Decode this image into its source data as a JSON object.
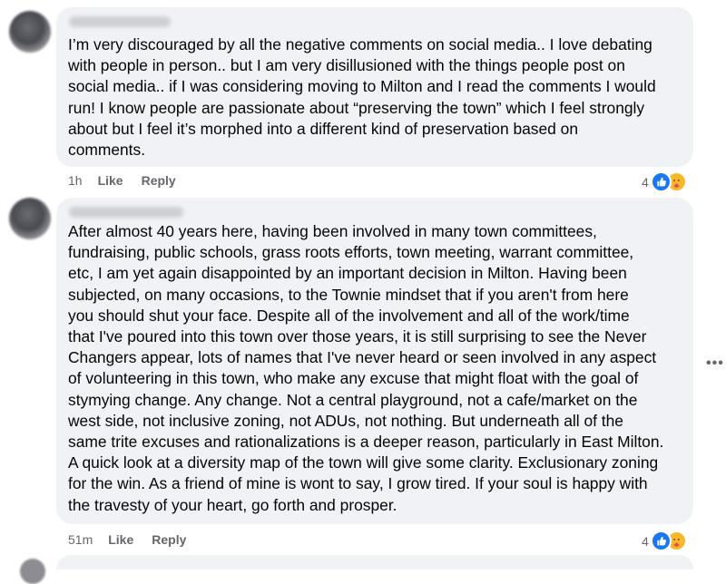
{
  "comments": [
    {
      "text": "I’m very discouraged by all the negative comments on social media.. I love debating\nwith people in person.. but I am very disillusioned with the things people post on\nsocial media.. if I was considering moving to Milton and I read the comments I would\nrun! I know people are passionate about “preserving the town” which I feel strongly\nabout but I feel it’s morphed into a different kind of preservation based on\ncomments.",
      "time": "1h",
      "like_label": "Like",
      "reply_label": "Reply",
      "reaction_count": "4"
    },
    {
      "text": "After almost 40 years here, having been involved in many town committees,\nfundraising, public schools, grass roots efforts, town meeting, warrant committee,\netc, I am yet again disappointed by an important decision in Milton. Having been\nsubjected, on many occasions, to the Townie mindset that if you aren't from here\nyou should shut your face. Despite all of the involvement and all of the work/time\nthat I've poured into this town over those years, it is still surprising to see the Never\nChangers appear, lots of names that I've never heard or seen involved in any aspect\nof volunteering in this town, who make any excuse that might float with the goal of\nstymying change. Any change. Not a central playground, not a cafe/market on the\nwest side, not inclusive zoning, not ADUs, not nothing. But underneath all of the\nsame trite excuses and rationalizations is a deeper reason, particularly in East Milton.\nA quick look at a diversity map of the town will give some clarity. Exclusionary zoning\nfor the win. As a friend of mine is wont to say, I grow tired. If your soul is happy with\nthe travesty of your heart, go forth and prosper.",
      "time": "51m",
      "like_label": "Like",
      "reply_label": "Reply",
      "reaction_count": "4"
    }
  ],
  "icons": {
    "like": "like-reaction-icon",
    "care": "care-reaction-icon",
    "more": "more-options-icon"
  },
  "colors": {
    "bubble": "#f0f2f5",
    "secondary_text": "#65676b",
    "like_blue": "#1877f2",
    "care_yellow": "#f7b928"
  },
  "more_glyph": "•••"
}
